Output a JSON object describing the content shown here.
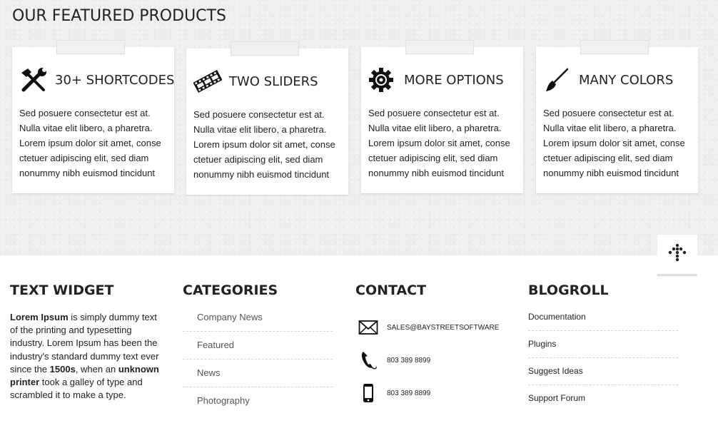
{
  "featured": {
    "title": "OUR FEATURED PRODUCTS",
    "cards": [
      {
        "title": "30+ SHORTCODES",
        "icon": "tools-icon",
        "text": "Sed posuere consectetur est at. Nulla vitae elit libero, a pharetra. Lorem ipsum dolor sit amet, conse ctetuer adipiscing elit, sed diam nonummy nibh euismod tincidunt"
      },
      {
        "title": "TWO SLIDERS",
        "icon": "film-strip-icon",
        "text": "Sed posuere consectetur est at. Nulla vitae elit libero, a pharetra. Lorem ipsum dolor sit amet, conse ctetuer adipiscing elit, sed diam nonummy nibh euismod tincidunt"
      },
      {
        "title": "MORE OPTIONS",
        "icon": "gear-icon",
        "text": "Sed posuere consectetur est at. Nulla vitae elit libero, a pharetra. Lorem ipsum dolor sit amet, conse ctetuer adipiscing elit, sed diam nonummy nibh euismod tincidunt"
      },
      {
        "title": "MANY COLORS",
        "icon": "paintbrush-icon",
        "text": "Sed posuere consectetur est at. Nulla vitae elit libero, a pharetra. Lorem ipsum dolor sit amet, conse ctetuer adipiscing elit, sed diam nonummy nibh euismod tincidunt"
      }
    ]
  },
  "scroll_top": {
    "icon": "scroll-to-top-icon"
  },
  "footer": {
    "text_widget": {
      "title": "TEXT WIDGET",
      "parts": [
        "Lorem Ipsum",
        " is simply dummy text of the printing and typesetting industry. Lorem Ipsum has been the industry's standard dummy text ever since the ",
        "1500s",
        ", when an ",
        "unknown printer",
        " took a galley of type and scrambled it to make a type."
      ]
    },
    "categories": {
      "title": "CATEGORIES",
      "items": [
        "Company News",
        "Featured",
        "News",
        "Photography"
      ]
    },
    "contact": {
      "title": "CONTACT",
      "email": "SALES@BAYSTREETSOFTWARE",
      "phone": "803 389 8899",
      "mobile": "803 389 8899",
      "icons": [
        "envelope-icon",
        "phone-icon",
        "mobile-phone-icon"
      ]
    },
    "blogroll": {
      "title": "BLOGROLL",
      "items": [
        "Documentation",
        "Plugins",
        "Suggest Ideas",
        "Support Forum"
      ]
    }
  }
}
